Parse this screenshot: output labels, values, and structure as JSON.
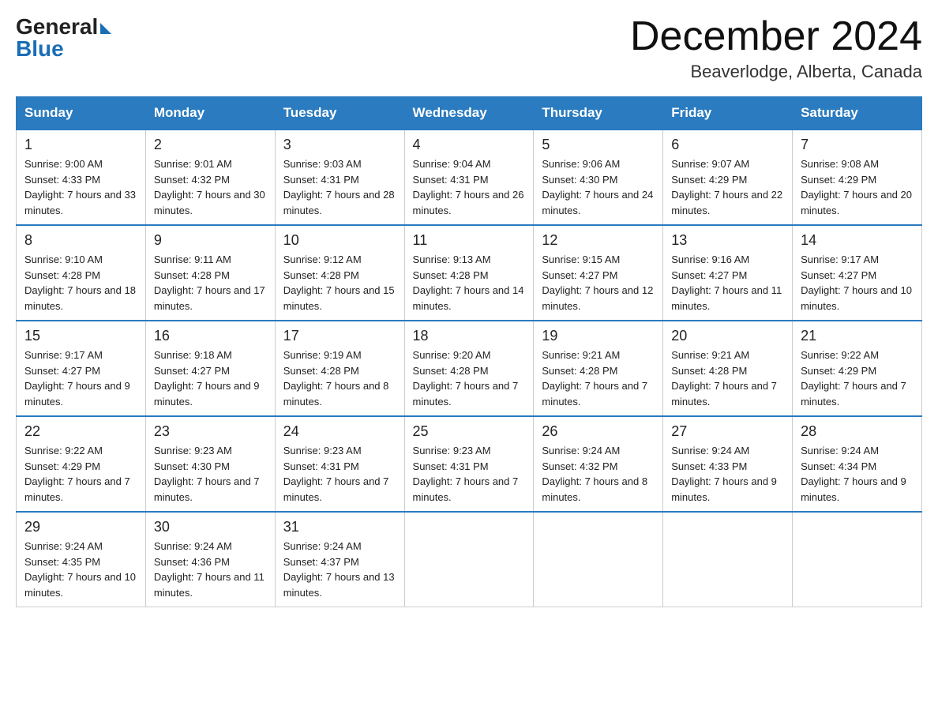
{
  "logo": {
    "general": "General",
    "blue": "Blue"
  },
  "title": "December 2024",
  "location": "Beaverlodge, Alberta, Canada",
  "days_of_week": [
    "Sunday",
    "Monday",
    "Tuesday",
    "Wednesday",
    "Thursday",
    "Friday",
    "Saturday"
  ],
  "weeks": [
    [
      {
        "day": "1",
        "sunrise": "9:00 AM",
        "sunset": "4:33 PM",
        "daylight": "7 hours and 33 minutes."
      },
      {
        "day": "2",
        "sunrise": "9:01 AM",
        "sunset": "4:32 PM",
        "daylight": "7 hours and 30 minutes."
      },
      {
        "day": "3",
        "sunrise": "9:03 AM",
        "sunset": "4:31 PM",
        "daylight": "7 hours and 28 minutes."
      },
      {
        "day": "4",
        "sunrise": "9:04 AM",
        "sunset": "4:31 PM",
        "daylight": "7 hours and 26 minutes."
      },
      {
        "day": "5",
        "sunrise": "9:06 AM",
        "sunset": "4:30 PM",
        "daylight": "7 hours and 24 minutes."
      },
      {
        "day": "6",
        "sunrise": "9:07 AM",
        "sunset": "4:29 PM",
        "daylight": "7 hours and 22 minutes."
      },
      {
        "day": "7",
        "sunrise": "9:08 AM",
        "sunset": "4:29 PM",
        "daylight": "7 hours and 20 minutes."
      }
    ],
    [
      {
        "day": "8",
        "sunrise": "9:10 AM",
        "sunset": "4:28 PM",
        "daylight": "7 hours and 18 minutes."
      },
      {
        "day": "9",
        "sunrise": "9:11 AM",
        "sunset": "4:28 PM",
        "daylight": "7 hours and 17 minutes."
      },
      {
        "day": "10",
        "sunrise": "9:12 AM",
        "sunset": "4:28 PM",
        "daylight": "7 hours and 15 minutes."
      },
      {
        "day": "11",
        "sunrise": "9:13 AM",
        "sunset": "4:28 PM",
        "daylight": "7 hours and 14 minutes."
      },
      {
        "day": "12",
        "sunrise": "9:15 AM",
        "sunset": "4:27 PM",
        "daylight": "7 hours and 12 minutes."
      },
      {
        "day": "13",
        "sunrise": "9:16 AM",
        "sunset": "4:27 PM",
        "daylight": "7 hours and 11 minutes."
      },
      {
        "day": "14",
        "sunrise": "9:17 AM",
        "sunset": "4:27 PM",
        "daylight": "7 hours and 10 minutes."
      }
    ],
    [
      {
        "day": "15",
        "sunrise": "9:17 AM",
        "sunset": "4:27 PM",
        "daylight": "7 hours and 9 minutes."
      },
      {
        "day": "16",
        "sunrise": "9:18 AM",
        "sunset": "4:27 PM",
        "daylight": "7 hours and 9 minutes."
      },
      {
        "day": "17",
        "sunrise": "9:19 AM",
        "sunset": "4:28 PM",
        "daylight": "7 hours and 8 minutes."
      },
      {
        "day": "18",
        "sunrise": "9:20 AM",
        "sunset": "4:28 PM",
        "daylight": "7 hours and 7 minutes."
      },
      {
        "day": "19",
        "sunrise": "9:21 AM",
        "sunset": "4:28 PM",
        "daylight": "7 hours and 7 minutes."
      },
      {
        "day": "20",
        "sunrise": "9:21 AM",
        "sunset": "4:28 PM",
        "daylight": "7 hours and 7 minutes."
      },
      {
        "day": "21",
        "sunrise": "9:22 AM",
        "sunset": "4:29 PM",
        "daylight": "7 hours and 7 minutes."
      }
    ],
    [
      {
        "day": "22",
        "sunrise": "9:22 AM",
        "sunset": "4:29 PM",
        "daylight": "7 hours and 7 minutes."
      },
      {
        "day": "23",
        "sunrise": "9:23 AM",
        "sunset": "4:30 PM",
        "daylight": "7 hours and 7 minutes."
      },
      {
        "day": "24",
        "sunrise": "9:23 AM",
        "sunset": "4:31 PM",
        "daylight": "7 hours and 7 minutes."
      },
      {
        "day": "25",
        "sunrise": "9:23 AM",
        "sunset": "4:31 PM",
        "daylight": "7 hours and 7 minutes."
      },
      {
        "day": "26",
        "sunrise": "9:24 AM",
        "sunset": "4:32 PM",
        "daylight": "7 hours and 8 minutes."
      },
      {
        "day": "27",
        "sunrise": "9:24 AM",
        "sunset": "4:33 PM",
        "daylight": "7 hours and 9 minutes."
      },
      {
        "day": "28",
        "sunrise": "9:24 AM",
        "sunset": "4:34 PM",
        "daylight": "7 hours and 9 minutes."
      }
    ],
    [
      {
        "day": "29",
        "sunrise": "9:24 AM",
        "sunset": "4:35 PM",
        "daylight": "7 hours and 10 minutes."
      },
      {
        "day": "30",
        "sunrise": "9:24 AM",
        "sunset": "4:36 PM",
        "daylight": "7 hours and 11 minutes."
      },
      {
        "day": "31",
        "sunrise": "9:24 AM",
        "sunset": "4:37 PM",
        "daylight": "7 hours and 13 minutes."
      },
      null,
      null,
      null,
      null
    ]
  ],
  "labels": {
    "sunrise": "Sunrise:",
    "sunset": "Sunset:",
    "daylight": "Daylight:"
  }
}
